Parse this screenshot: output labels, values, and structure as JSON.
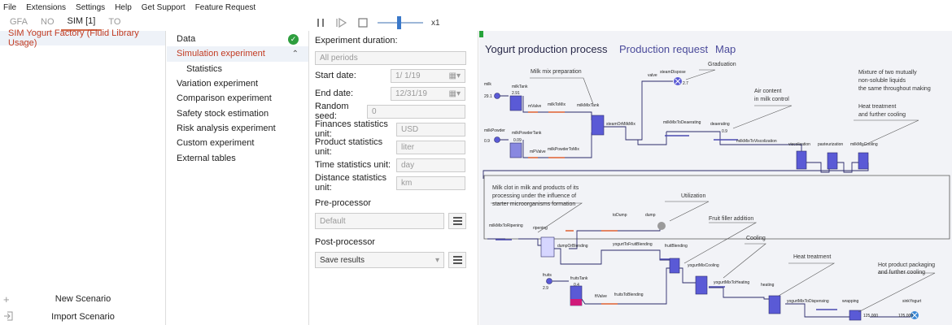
{
  "menu": [
    "File",
    "Extensions",
    "Settings",
    "Help",
    "Get Support",
    "Feature Request"
  ],
  "tabs": [
    {
      "label": "GFA",
      "active": false
    },
    {
      "label": "NO",
      "active": false
    },
    {
      "label": "SIM [1]",
      "active": true
    },
    {
      "label": "TO",
      "active": false
    }
  ],
  "toolbar": {
    "speed_label": "x1"
  },
  "scenarios": {
    "selected": "SIM Yogurt Factory (Fluid Library Usage)",
    "new_label": "New Scenario",
    "import_label": "Import Scenario"
  },
  "experiments": [
    {
      "label": "Data",
      "status": "ok"
    },
    {
      "label": "Simulation experiment",
      "selected": true
    },
    {
      "label": "Statistics",
      "sub": true
    },
    {
      "label": "Variation experiment"
    },
    {
      "label": "Comparison experiment"
    },
    {
      "label": "Safety stock estimation"
    },
    {
      "label": "Risk analysis experiment"
    },
    {
      "label": "Custom experiment"
    },
    {
      "label": "External tables"
    }
  ],
  "props": {
    "duration_label": "Experiment duration:",
    "duration_value": "All periods",
    "start_label": "Start date:",
    "start_value": "1/  1/19",
    "end_label": "End date:",
    "end_value": "12/31/19",
    "seed_label": "Random seed:",
    "seed_value": "0",
    "finance_label": "Finances statistics unit:",
    "finance_value": "USD",
    "product_label": "Product statistics unit:",
    "product_value": "liter",
    "time_label": "Time statistics unit:",
    "time_value": "day",
    "distance_label": "Distance statistics unit:",
    "distance_value": "km",
    "pre_label": "Pre-processor",
    "pre_value": "Default",
    "post_label": "Post-processor",
    "post_value": "Save results"
  },
  "canvas": {
    "title": "Yogurt production process",
    "link1": "Production request",
    "link2": "Map",
    "notes": [
      "Milk mix preparation",
      "Graduation",
      "Air content",
      "in milk control",
      "Mixture of two mutually",
      "non-soluble liquids",
      "the same throughout making",
      "Heat treatment",
      "and further cooling",
      "Milk clot in milk and products of its",
      "processing under the influence of",
      "starter microorganisms formation",
      "Utilization",
      "Fruit filler addition",
      "Cooling",
      "Heat treatment",
      "Hot product packaging",
      "and further cooling"
    ],
    "labels": {
      "milk": "milk",
      "milkTank": "milkTank",
      "mValve": "mValve",
      "milkToMix": "milkToMix",
      "milkPowder": "milkPowder",
      "milkPowderTank": "milkPowderTank",
      "mPValve": "mPValve",
      "milkPowderToMix": "milkPowderToMix",
      "milkMixTank": "milkMixTank",
      "steamOrMilkMix": "steamOrMilkMix",
      "valve": "valve",
      "steamDispose": "steamDispose",
      "milkMixToDeaerating": "milkMixToDeaerating",
      "deaerating": "deaerating",
      "milkMixToViscolization": "milkMixToViscolization",
      "viscolization": "viscolization",
      "pasteurization": "pasteurization",
      "milkMixCooling": "milkMixCooling",
      "milkMixToRipening": "milkMixToRipening",
      "ripening": "ripening",
      "dumpOrBlending": "dumpOrBlending",
      "toDump": "toDump",
      "dump": "dump",
      "yogurtToFruitBlending": "yogurtToFruitBlending",
      "fruitBlending": "fruitBlending",
      "fruits": "fruits",
      "fruitsTank": "fruitsTank",
      "ftValve": "ftValve",
      "fruitsToBlending": "fruitsToBlending",
      "yogurtMixCooling": "yogurtMixCooling",
      "yogurtMixToHeating": "yogurtMixToHeating",
      "heating": "heating",
      "yogurtMixToDispensing": "yogurtMixToDispensing",
      "wrapping": "wrapping",
      "sinkYogurt": "sinkYogurt"
    },
    "values": {
      "milk": "29.1",
      "milkTank": "2.91",
      "milkPowder": "0.9",
      "milkPowderTank": "0.09",
      "steamDispose": "2.7",
      "deaerating": "0.9",
      "fruits": "2.9",
      "fruitsTank": "0.4",
      "wrapping": "125,000",
      "sinkYogurt": "125,000",
      "zero": "0"
    }
  },
  "colors": {
    "accent": "#c23b22",
    "tank": "#5a5ad6",
    "pipe": "#2a2a6a",
    "fruit": "#d0197a",
    "ok": "#2e9e3e",
    "progress": "#26a33a"
  }
}
